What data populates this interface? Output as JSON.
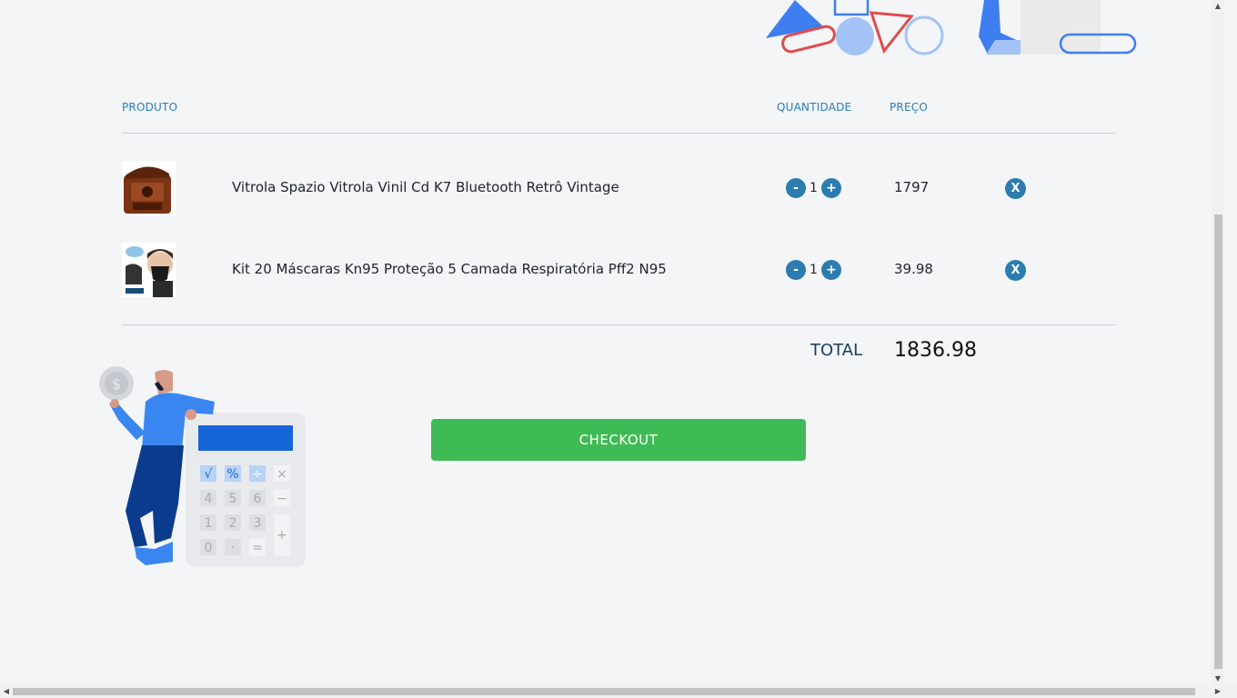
{
  "table": {
    "headers": {
      "product": "PRODUTO",
      "quantity": "QUANTIDADE",
      "price": "PREÇO"
    }
  },
  "items": [
    {
      "name": "Vitrola Spazio Vitrola Vinil Cd K7 Bluetooth Retrô Vintage",
      "quantity": "1",
      "price": "1797",
      "minus_label": "-",
      "plus_label": "+",
      "remove_label": "X"
    },
    {
      "name": "Kit 20 Máscaras Kn95 Proteção 5 Camada Respiratória Pff2 N95",
      "quantity": "1",
      "price": "39.98",
      "minus_label": "-",
      "plus_label": "+",
      "remove_label": "X"
    }
  ],
  "summary": {
    "total_label": "TOTAL",
    "total_value": "1836.98"
  },
  "checkout": {
    "label": "CHECKOUT"
  },
  "colors": {
    "accent": "#2d7cb0",
    "checkout": "#3fbb55",
    "header_text": "#2d7fb4"
  },
  "icons": [
    "decorative-shapes-icon",
    "record-player-thumbnail",
    "masks-thumbnail",
    "calculator-illustration"
  ]
}
